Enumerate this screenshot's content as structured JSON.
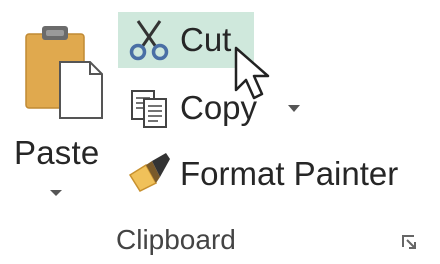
{
  "clipboard": {
    "group_label": "Clipboard",
    "paste": {
      "label": "Paste",
      "icon": "paste-icon"
    },
    "cut": {
      "label": "Cut",
      "icon": "scissors-icon",
      "state": "hover"
    },
    "copy": {
      "label": "Copy",
      "icon": "copy-icon"
    },
    "format_painter": {
      "label": "Format Painter",
      "icon": "paintbrush-icon"
    },
    "launcher_icon": "dialog-launcher-icon"
  },
  "colors": {
    "hover_bg": "#cfe8dc",
    "text": "#262626",
    "clipboard_body": "#e0a94e",
    "scissors": "#4a6fa5"
  }
}
